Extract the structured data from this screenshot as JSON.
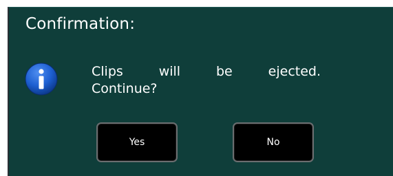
{
  "dialog": {
    "title": "Confirmation:",
    "icon": "info-icon",
    "message": {
      "words_line1": [
        "Clips",
        "will",
        "be",
        "ejected."
      ],
      "line2": "Continue?"
    },
    "buttons": {
      "yes_label": "Yes",
      "no_label": "No"
    }
  },
  "colors": {
    "background": "#0f3e3a",
    "button_bg": "#000000",
    "button_border": "#6b6e70",
    "icon_blue": "#1d5fd1",
    "text": "#ffffff"
  }
}
